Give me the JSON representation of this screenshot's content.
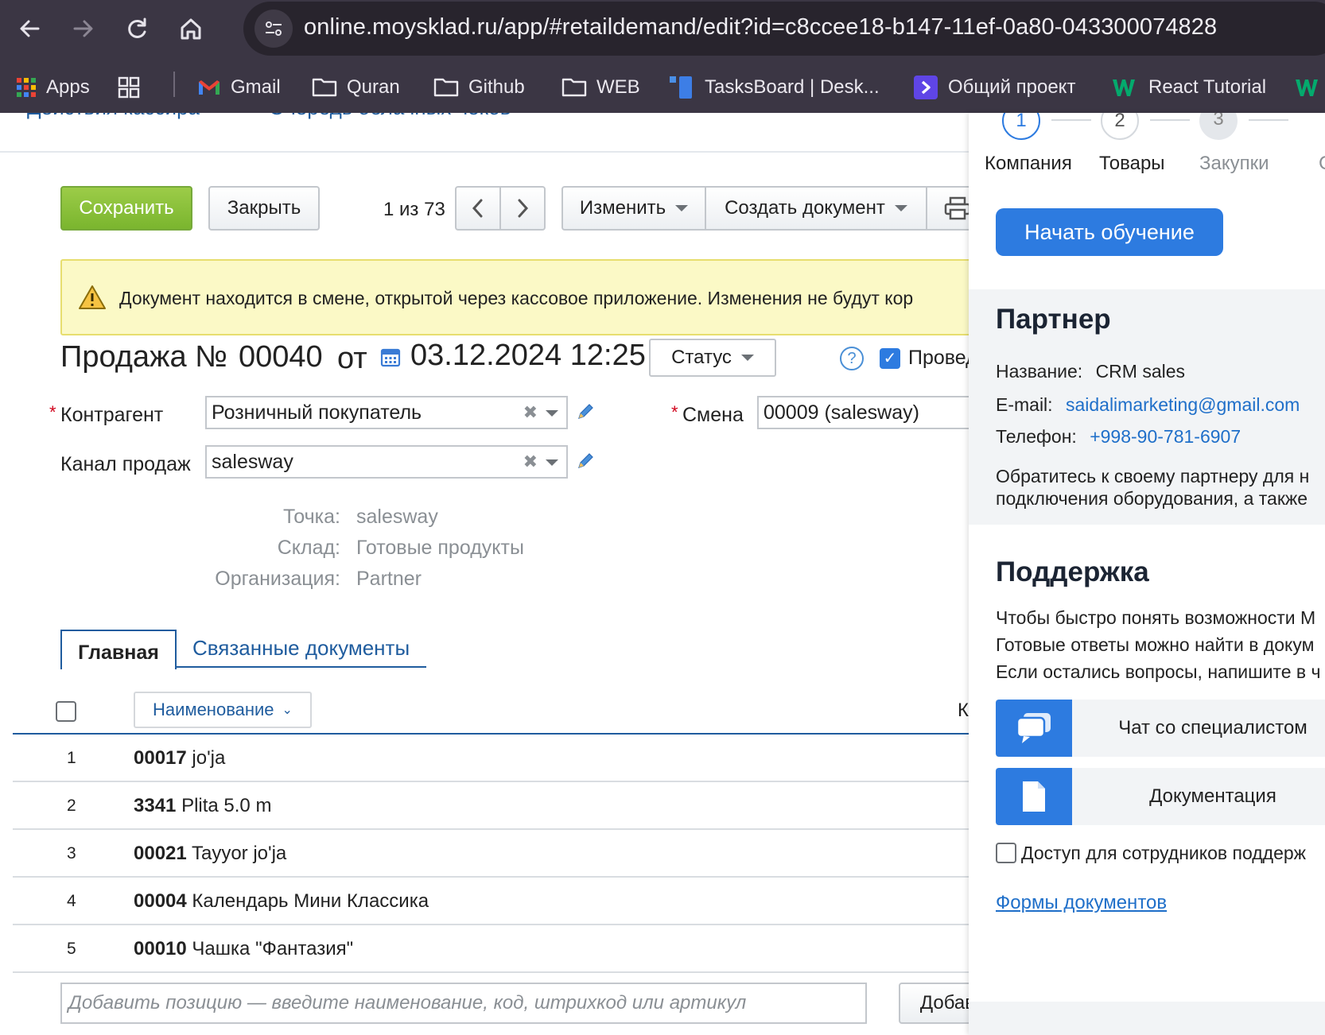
{
  "browser": {
    "url": "online.moysklad.ru/app/#retaildemand/edit?id=c8ccee18-b147-11ef-0a80-043300074828",
    "bookmarks": [
      {
        "label": "Apps",
        "icon": "apps-grid-icon"
      },
      {
        "label": "",
        "icon": "tab-groups-icon"
      },
      {
        "label": "Gmail",
        "icon": "gmail-icon"
      },
      {
        "label": "Quran",
        "icon": "folder-icon"
      },
      {
        "label": "Github",
        "icon": "folder-icon"
      },
      {
        "label": "WEB",
        "icon": "folder-icon"
      },
      {
        "label": "TasksBoard | Desk...",
        "icon": "tasksboard-icon"
      },
      {
        "label": "Общий проект",
        "icon": "arrow-app-icon"
      },
      {
        "label": "React Tutorial",
        "icon": "w3schools-icon"
      }
    ]
  },
  "top_tabs": [
    "Действия кассира",
    "Очередь облачных чеков"
  ],
  "toolbar": {
    "save": "Сохранить",
    "close": "Закрыть",
    "pager": "1 из 73",
    "change": "Изменить",
    "create_doc": "Создать документ"
  },
  "warning": "Документ находится в смене, открытой через кассовое приложение. Изменения не будут кор",
  "doc": {
    "title": "Продажа №",
    "number": "00040",
    "from": "от",
    "date": "03.12.2024 12:25",
    "status": "Статус",
    "posted_label": "Провед",
    "posted": true
  },
  "form": {
    "counterparty_label": "Контрагент",
    "counterparty_value": "Розничный покупатель",
    "shift_label": "Смена",
    "shift_value": "00009 (salesway)",
    "channel_label": "Канал продаж",
    "channel_value": "salesway",
    "point_label": "Точка:",
    "point_value": "salesway",
    "warehouse_label": "Склад:",
    "warehouse_value": "Готовые продукты",
    "org_label": "Организация:",
    "org_value": "Partner"
  },
  "tabs": {
    "main": "Главная",
    "related": "Связанные документы"
  },
  "table": {
    "name_column": "Наименование",
    "k_column": "К",
    "rows": [
      {
        "n": "1",
        "code": "00017",
        "name": "jo'ja"
      },
      {
        "n": "2",
        "code": "3341",
        "name": "Plita 5.0 m"
      },
      {
        "n": "3",
        "code": "00021",
        "name": "Tayyor jo'ja"
      },
      {
        "n": "4",
        "code": "00004",
        "name": "Календарь Мини Классика"
      },
      {
        "n": "5",
        "code": "00010",
        "name": "Чашка \"Фантазия\""
      }
    ],
    "add_placeholder": "Добавить позицию — введите наименование, код, штрихкод или артикул",
    "add_from_catalog": "Добавить из справочника"
  },
  "panel": {
    "steps": [
      {
        "n": "1",
        "label": "Компания",
        "state": "active"
      },
      {
        "n": "2",
        "label": "Товары",
        "state": "default"
      },
      {
        "n": "3",
        "label": "Закупки",
        "state": "muted"
      },
      {
        "n": "",
        "label": "С",
        "state": "muted"
      }
    ],
    "start_learning": "Начать обучение",
    "partner": {
      "heading": "Партнер",
      "name_label": "Название:",
      "name_value": "CRM sales",
      "email_label": "E-mail:",
      "email_value": "saidalimarketing@gmail.com",
      "phone_label": "Телефон:",
      "phone_value": "+998-90-781-6907",
      "note_line1": "Обратитесь к своему партнеру для н",
      "note_line2": "подключения оборудования, а также"
    },
    "support": {
      "heading": "Поддержка",
      "line1": "Чтобы быстро понять возможности М",
      "line2": "Готовые ответы можно найти в докум",
      "line3": "Если остались вопросы, напишите в ч",
      "chat": "Чат со специалистом",
      "docs": "Документация",
      "access": "Доступ для сотрудников поддерж",
      "forms": "Формы документов"
    }
  },
  "colors": {
    "chrome_bg": "#3b3644",
    "save_green": "#8cc13c",
    "accent_blue": "#2d7be0",
    "link_blue": "#1f5c9e",
    "warning_bg": "#fbf9c6"
  }
}
